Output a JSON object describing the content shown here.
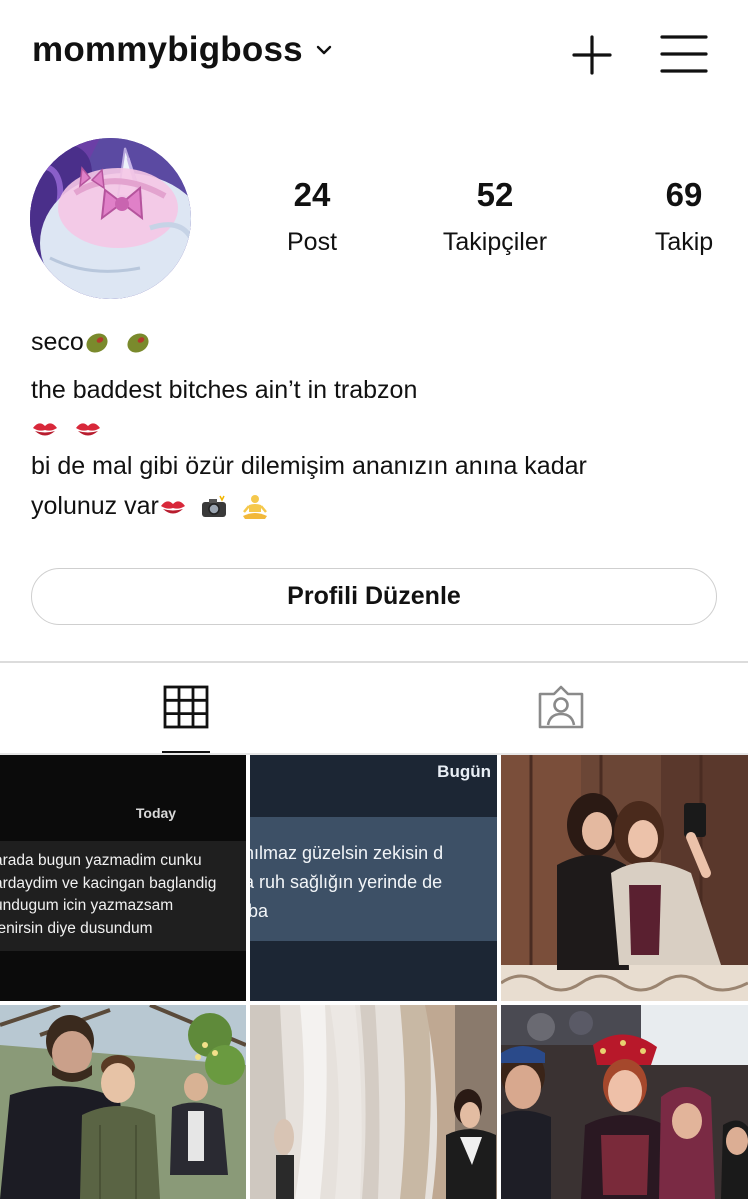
{
  "header": {
    "username": "mommybigboss",
    "icons": {
      "dropdown": "chevron-down-icon",
      "new_post": "plus-icon",
      "menu": "hamburger-menu-icon"
    }
  },
  "profile": {
    "avatar_icon": "profile-avatar",
    "stats": [
      {
        "value": "24",
        "label": "Post"
      },
      {
        "value": "52",
        "label": "Takipçiler"
      },
      {
        "value": "69",
        "label": "Takip"
      }
    ]
  },
  "bio": {
    "name": "seco",
    "line1": "the baddest bitches ain’t in trabzon",
    "line3": "bi de mal gibi özür dilemişim ananızın anına kadar",
    "line4": "yolunuz var"
  },
  "edit_button": {
    "label": "Profili Düzenle"
  },
  "tabs": {
    "grid_icon": "grid-icon",
    "tagged_icon": "tagged-person-icon"
  },
  "posts": {
    "post1": {
      "header": "Today",
      "lines": [
        "arada bugun yazmadim cunku",
        "ardaydim ve kacingan baglandig",
        "undugum icin yazmazsam",
        "lenirsin diye dusundum"
      ]
    },
    "post2": {
      "header": "Bugün",
      "lines": [
        "nılmaz güzelsin zekisin d",
        "a ruh sağlığın yerinde de",
        "iba"
      ]
    }
  },
  "colors": {
    "text": "#111111",
    "border": "#cfcfcf",
    "divider": "#dcdcdc"
  }
}
